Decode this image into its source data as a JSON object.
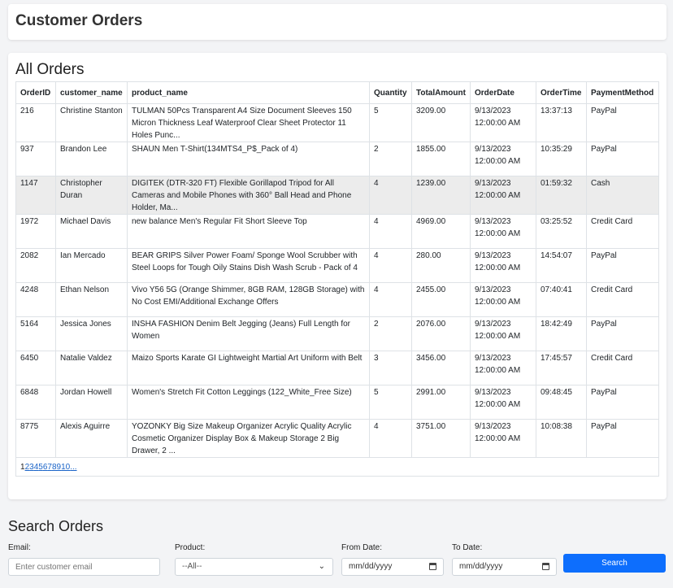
{
  "header": {
    "title": "Customer Orders"
  },
  "orders": {
    "title": "All Orders",
    "columns": [
      "OrderID",
      "customer_name",
      "product_name",
      "Quantity",
      "TotalAmount",
      "OrderDate",
      "OrderTime",
      "PaymentMethod"
    ],
    "rows": [
      {
        "id": "216",
        "customer": "Christine Stanton",
        "product": "TULMAN 50Pcs Transparent A4 Size Document Sleeves 150 Micron Thickness Leaf Waterproof Clear Sheet Protector 11 Holes Punc...",
        "qty": "5",
        "total": "3209.00",
        "date": "9/13/2023 12:00:00 AM",
        "time": "13:37:13",
        "payment": "PayPal"
      },
      {
        "id": "937",
        "customer": "Brandon Lee",
        "product": "SHAUN Men T-Shirt(134MTS4_P$_Pack of 4)",
        "qty": "2",
        "total": "1855.00",
        "date": "9/13/2023 12:00:00 AM",
        "time": "10:35:29",
        "payment": "PayPal"
      },
      {
        "id": "1147",
        "customer": "Christopher Duran",
        "product": "DIGITEK (DTR-320 FT) Flexible Gorillapod Tripod for All Cameras and Mobile Phones with 360° Ball Head and Phone Holder, Ma...",
        "qty": "4",
        "total": "1239.00",
        "date": "9/13/2023 12:00:00 AM",
        "time": "01:59:32",
        "payment": "Cash"
      },
      {
        "id": "1972",
        "customer": "Michael Davis",
        "product": "new balance Men's Regular Fit Short Sleeve Top",
        "qty": "4",
        "total": "4969.00",
        "date": "9/13/2023 12:00:00 AM",
        "time": "03:25:52",
        "payment": "Credit Card"
      },
      {
        "id": "2082",
        "customer": "Ian Mercado",
        "product": "BEAR GRIPS Silver Power Foam/ Sponge Wool Scrubber with Steel Loops for Tough Oily Stains Dish Wash Scrub - Pack of 4",
        "qty": "4",
        "total": "280.00",
        "date": "9/13/2023 12:00:00 AM",
        "time": "14:54:07",
        "payment": "PayPal"
      },
      {
        "id": "4248",
        "customer": "Ethan Nelson",
        "product": "Vivo Y56 5G (Orange Shimmer, 8GB RAM, 128GB Storage) with No Cost EMI/Additional Exchange Offers",
        "qty": "4",
        "total": "2455.00",
        "date": "9/13/2023 12:00:00 AM",
        "time": "07:40:41",
        "payment": "Credit Card"
      },
      {
        "id": "5164",
        "customer": "Jessica Jones",
        "product": "INSHA FASHION Denim Belt Jegging (Jeans) Full Length for Women",
        "qty": "2",
        "total": "2076.00",
        "date": "9/13/2023 12:00:00 AM",
        "time": "18:42:49",
        "payment": "PayPal"
      },
      {
        "id": "6450",
        "customer": "Natalie Valdez",
        "product": "Maizo Sports Karate GI Lightweight Martial Art Uniform with Belt",
        "qty": "3",
        "total": "3456.00",
        "date": "9/13/2023 12:00:00 AM",
        "time": "17:45:57",
        "payment": "Credit Card"
      },
      {
        "id": "6848",
        "customer": "Jordan Howell",
        "product": "Women's Stretch Fit Cotton Leggings (122_White_Free Size)",
        "qty": "5",
        "total": "2991.00",
        "date": "9/13/2023 12:00:00 AM",
        "time": "09:48:45",
        "payment": "PayPal"
      },
      {
        "id": "8775",
        "customer": "Alexis Aguirre",
        "product": "YOZONKY Big Size Makeup Organizer Acrylic Quality Acrylic Cosmetic Organizer Display Box & Makeup Storage 2 Big Drawer, 2 ...",
        "qty": "4",
        "total": "3751.00",
        "date": "9/13/2023 12:00:00 AM",
        "time": "10:08:38",
        "payment": "PayPal"
      }
    ],
    "highlighted_row": 2,
    "pagination": {
      "current": "1",
      "pages": [
        "2",
        "3",
        "4",
        "5",
        "6",
        "7",
        "8",
        "9",
        "10",
        "..."
      ]
    }
  },
  "search": {
    "title": "Search Orders",
    "email_label": "Email:",
    "email_placeholder": "Enter customer email",
    "product_label": "Product:",
    "product_selected": "--All--",
    "from_label": "From Date:",
    "from_placeholder": "mm/dd/yyyy",
    "to_label": "To Date:",
    "to_placeholder": "mm/dd/yyyy",
    "button_label": "Search"
  },
  "colors": {
    "accent": "#0d6efd",
    "link": "#1a64c8",
    "highlight_row": "#ececec"
  }
}
